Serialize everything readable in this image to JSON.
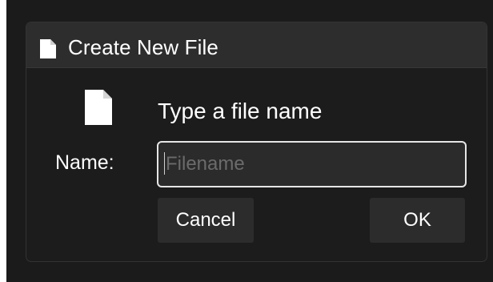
{
  "dialog": {
    "title": "Create New File",
    "title_icon": "file-icon",
    "doc_icon": "document-icon",
    "heading": "Type a file name",
    "name_label": "Name:",
    "input": {
      "value": "",
      "placeholder": "Filename"
    },
    "cancel_label": "Cancel",
    "ok_label": "OK"
  },
  "colors": {
    "background": "#1b1b1b",
    "titlebar": "#2d2d2d",
    "input_border": "#e6e6e6",
    "button": "#2c2c2c",
    "text": "#ffffff"
  }
}
